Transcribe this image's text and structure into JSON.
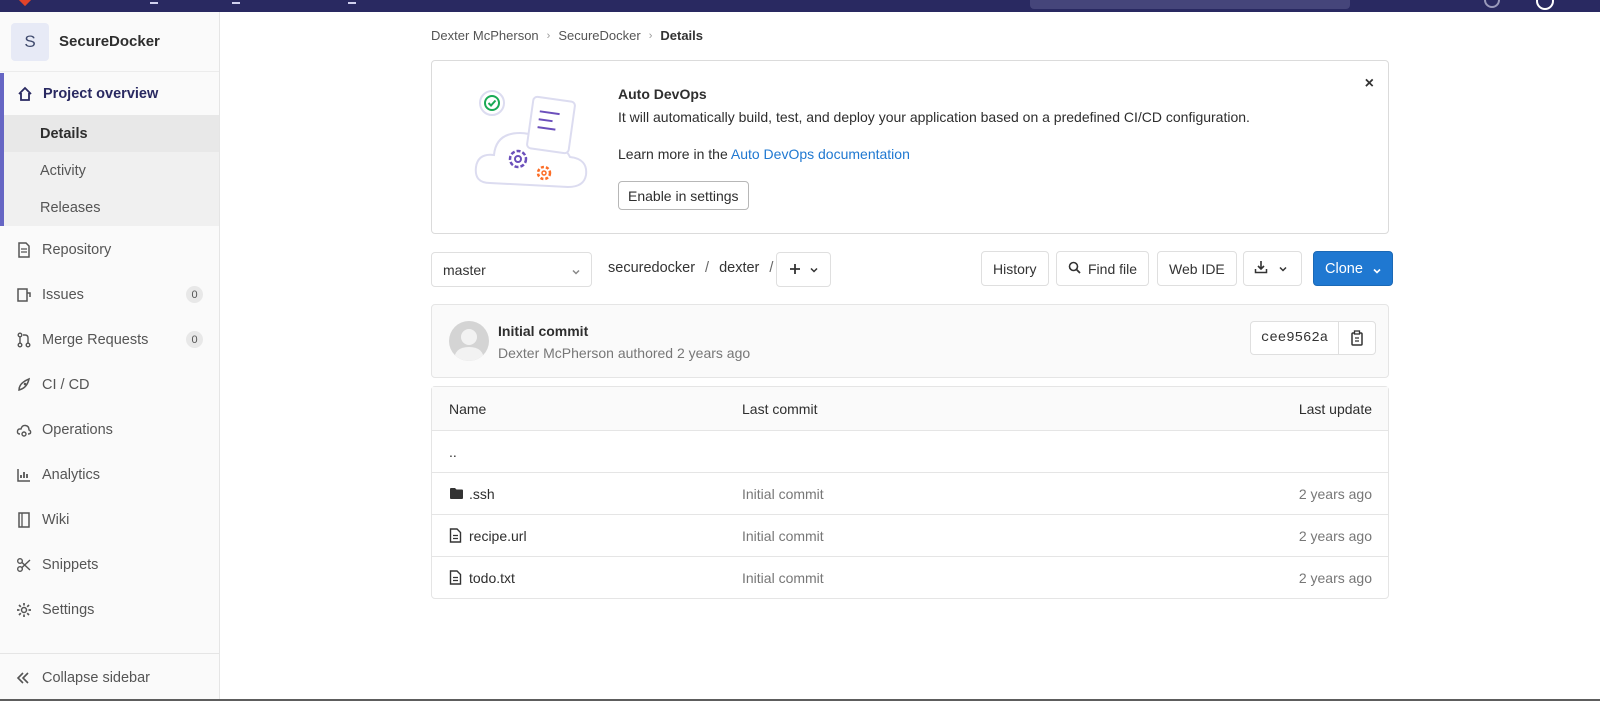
{
  "project": {
    "avatar_letter": "S",
    "name": "SecureDocker"
  },
  "sidebar": {
    "overview": {
      "label": "Project overview",
      "sub_items": [
        {
          "label": "Details",
          "active": true
        },
        {
          "label": "Activity",
          "active": false
        },
        {
          "label": "Releases",
          "active": false
        }
      ]
    },
    "items": [
      {
        "label": "Repository",
        "icon": "document-icon"
      },
      {
        "label": "Issues",
        "icon": "issues-icon",
        "count": "0"
      },
      {
        "label": "Merge Requests",
        "icon": "merge-request-icon",
        "count": "0"
      },
      {
        "label": "CI / CD",
        "icon": "rocket-icon"
      },
      {
        "label": "Operations",
        "icon": "cloud-gear-icon"
      },
      {
        "label": "Analytics",
        "icon": "chart-icon"
      },
      {
        "label": "Wiki",
        "icon": "book-icon"
      },
      {
        "label": "Snippets",
        "icon": "scissors-icon"
      },
      {
        "label": "Settings",
        "icon": "gear-icon"
      }
    ],
    "collapse_label": "Collapse sidebar"
  },
  "breadcrumb": {
    "items": [
      "Dexter McPherson",
      "SecureDocker",
      "Details"
    ]
  },
  "banner": {
    "title": "Auto DevOps",
    "description": "It will automatically build, test, and deploy your application based on a predefined CI/CD configuration.",
    "learn_prefix": "Learn more in the",
    "learn_link": "Auto DevOps documentation",
    "button_label": "Enable in settings",
    "close_symbol": "×"
  },
  "toolbar": {
    "branch": "master",
    "path": [
      "securedocker",
      "dexter"
    ],
    "history_label": "History",
    "find_file_label": "Find file",
    "web_ide_label": "Web IDE",
    "clone_label": "Clone"
  },
  "last_commit": {
    "title": "Initial commit",
    "author": "Dexter McPherson",
    "meta_suffix": "authored 2 years ago",
    "sha": "cee9562a"
  },
  "file_table": {
    "headers": [
      "Name",
      "Last commit",
      "Last update"
    ],
    "parent_link": "..",
    "rows": [
      {
        "name": ".ssh",
        "type": "folder",
        "commit": "Initial commit",
        "updated": "2 years ago"
      },
      {
        "name": "recipe.url",
        "type": "file",
        "commit": "Initial commit",
        "updated": "2 years ago"
      },
      {
        "name": "todo.txt",
        "type": "file",
        "commit": "Initial commit",
        "updated": "2 years ago"
      }
    ]
  },
  "colors": {
    "navbar": "#292961",
    "accent": "#6666c4",
    "primary_button": "#1f78d1",
    "link": "#1f78d1"
  }
}
